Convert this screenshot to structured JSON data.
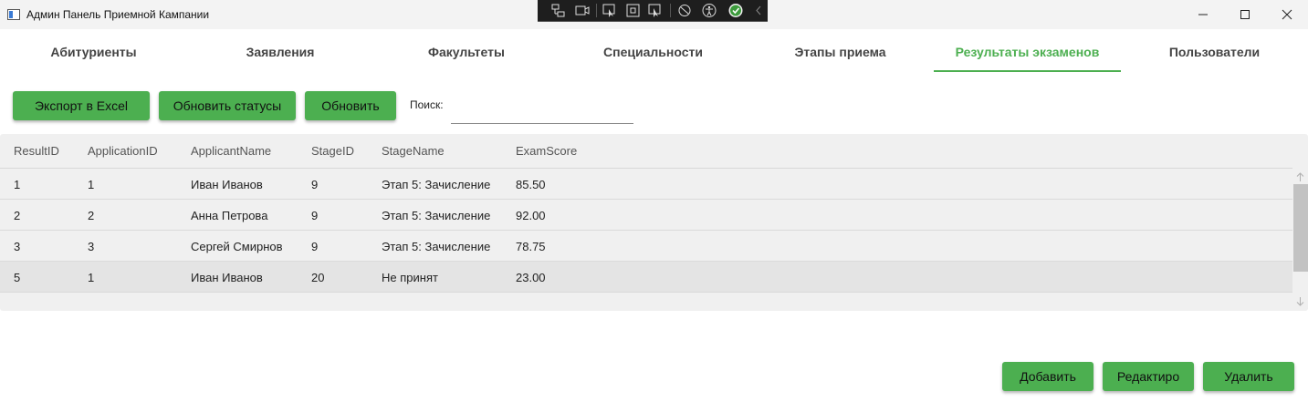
{
  "window": {
    "title": "Админ Панель Приемной Кампании"
  },
  "tabs": [
    {
      "label": "Абитуриенты"
    },
    {
      "label": "Заявления"
    },
    {
      "label": "Факультеты"
    },
    {
      "label": "Специальности"
    },
    {
      "label": "Этапы приема"
    },
    {
      "label": "Результаты экзаменов",
      "active": true
    },
    {
      "label": "Пользователи"
    }
  ],
  "toolbar": {
    "export_label": "Экспорт в Excel",
    "update_statuses_label": "Обновить статусы",
    "refresh_label": "Обновить",
    "search_label": "Поиск:",
    "search_value": ""
  },
  "table": {
    "columns": [
      "ResultID",
      "ApplicationID",
      "ApplicantName",
      "StageID",
      "StageName",
      "ExamScore"
    ],
    "rows": [
      [
        "1",
        "1",
        "Иван Иванов",
        "9",
        "Этап 5: Зачисление",
        "85.50"
      ],
      [
        "2",
        "2",
        "Анна Петрова",
        "9",
        "Этап 5: Зачисление",
        "92.00"
      ],
      [
        "3",
        "3",
        "Сергей Смирнов",
        "9",
        "Этап 5: Зачисление",
        "78.75"
      ],
      [
        "5",
        "1",
        "Иван Иванов",
        "20",
        "Не принят",
        "23.00"
      ]
    ],
    "selected_row": 3
  },
  "actions": {
    "add_label": "Добавить",
    "edit_label": "Редактиро",
    "delete_label": "Удалить"
  },
  "colors": {
    "accent": "#4caf50",
    "grid_bg": "#f0f0f0"
  },
  "icons": [
    "app-icon",
    "minimize-icon",
    "maximize-icon",
    "close-icon",
    "live-visual-tree-icon",
    "select-element-icon",
    "display-layout-adorners-icon",
    "track-focus-icon",
    "accessibility-icon",
    "binding-check-icon",
    "collapse-chevron-icon",
    "scroll-up-icon",
    "scroll-down-icon"
  ]
}
